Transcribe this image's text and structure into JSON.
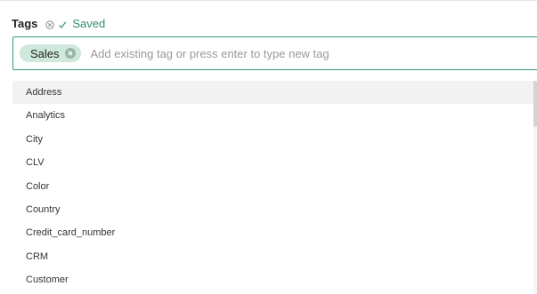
{
  "header": {
    "title": "Tags",
    "status": "Saved",
    "clear_icon": "circle-x-icon",
    "check_icon": "checkmark-icon",
    "status_color": "#2f8d6b"
  },
  "input": {
    "chips": [
      {
        "label": "Sales",
        "remove_icon": "circle-x-icon"
      }
    ],
    "value": "",
    "placeholder": "Add existing tag or press enter to type new tag",
    "border_color": "#3a9b73",
    "chip_color": "#cfe8dc"
  },
  "dropdown": {
    "highlighted_index": 0,
    "options": [
      "Address",
      "Analytics",
      "City",
      "CLV",
      "Color",
      "Country",
      "Credit_card_number",
      "CRM",
      "Customer"
    ]
  }
}
